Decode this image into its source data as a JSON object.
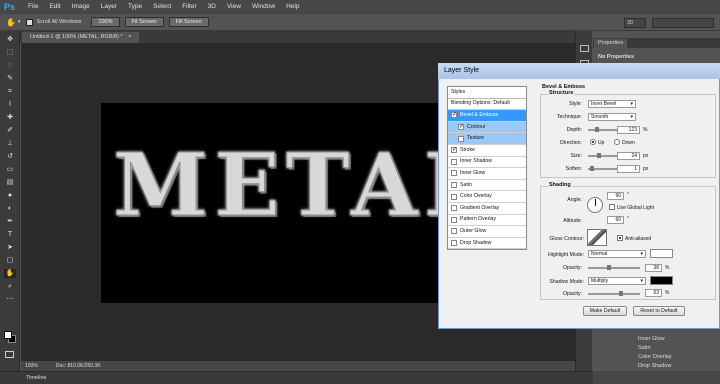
{
  "menu": [
    "File",
    "Edit",
    "Image",
    "Layer",
    "Type",
    "Select",
    "Filter",
    "3D",
    "View",
    "Window",
    "Help"
  ],
  "logo": "Ps",
  "options": {
    "scroll_all": "Scroll All Windows",
    "zoom": "100%",
    "fit": "Fit Screen",
    "fill": "Fill Screen",
    "workspace": "3D"
  },
  "document": {
    "tab": "Untitled-1 @ 100% (METAL, RGB/8) *",
    "close": "×",
    "art_text": "METAL",
    "zoom": "100%",
    "doc_size": "Doc: 810.0K/250.3K",
    "timeline": "Timeline"
  },
  "properties": {
    "tab": "Properties",
    "empty": "No Properties"
  },
  "layer_effects": [
    "Inner Glow",
    "Satin",
    "Color Overlay",
    "Drop Shadow"
  ],
  "dialog": {
    "title": "Layer Style",
    "styles_header": "Styles",
    "items": [
      {
        "label": "Blending Options: Default",
        "check": false,
        "hascb": false
      },
      {
        "label": "Bevel & Emboss",
        "check": true,
        "hascb": true
      },
      {
        "label": "Contour",
        "check": true,
        "hascb": true
      },
      {
        "label": "Texture",
        "check": false,
        "hascb": true
      },
      {
        "label": "Stroke",
        "check": true,
        "hascb": true
      },
      {
        "label": "Inner Shadow",
        "check": false,
        "hascb": true
      },
      {
        "label": "Inner Glow",
        "check": false,
        "hascb": true
      },
      {
        "label": "Satin",
        "check": false,
        "hascb": true
      },
      {
        "label": "Color Overlay",
        "check": false,
        "hascb": true
      },
      {
        "label": "Gradient Overlay",
        "check": false,
        "hascb": true
      },
      {
        "label": "Pattern Overlay",
        "check": false,
        "hascb": true
      },
      {
        "label": "Outer Glow",
        "check": false,
        "hascb": true
      },
      {
        "label": "Drop Shadow",
        "check": false,
        "hascb": true
      }
    ],
    "section": "Bevel & Emboss",
    "structure": "Structure",
    "style_label": "Style:",
    "style_value": "Inner Bevel",
    "technique_label": "Technique:",
    "technique_value": "Smooth",
    "depth_label": "Depth:",
    "depth_value": "123",
    "depth_level": 0.12,
    "direction_label": "Direction:",
    "up": "Up",
    "down": "Down",
    "size_label": "Size:",
    "size_value": "24",
    "size_level": 0.16,
    "soften_label": "Soften:",
    "soften_value": "1",
    "soften_level": 0.02,
    "shading": "Shading",
    "angle_label": "Angle:",
    "angle_value": "90",
    "global_light": "Use Global Light",
    "altitude_label": "Altitude:",
    "altitude_value": "60",
    "gloss_label": "Gloss Contour:",
    "anti_aliased": "Anti-aliased",
    "highlight_label": "Highlight Mode:",
    "highlight_value": "Normal",
    "highlight_color": "#ffffff",
    "hl_opacity_label": "Opacity:",
    "hl_opacity_value": "38",
    "hl_opacity_level": 0.38,
    "shadow_label": "Shadow Mode:",
    "shadow_value": "Multiply",
    "shadow_color": "#000000",
    "sh_opacity_label": "Opacity:",
    "sh_opacity_value": "63",
    "sh_opacity_level": 0.63,
    "make_default": "Make Default",
    "reset_default": "Reset to Default",
    "px": "px",
    "pct": "%",
    "deg": "°"
  }
}
